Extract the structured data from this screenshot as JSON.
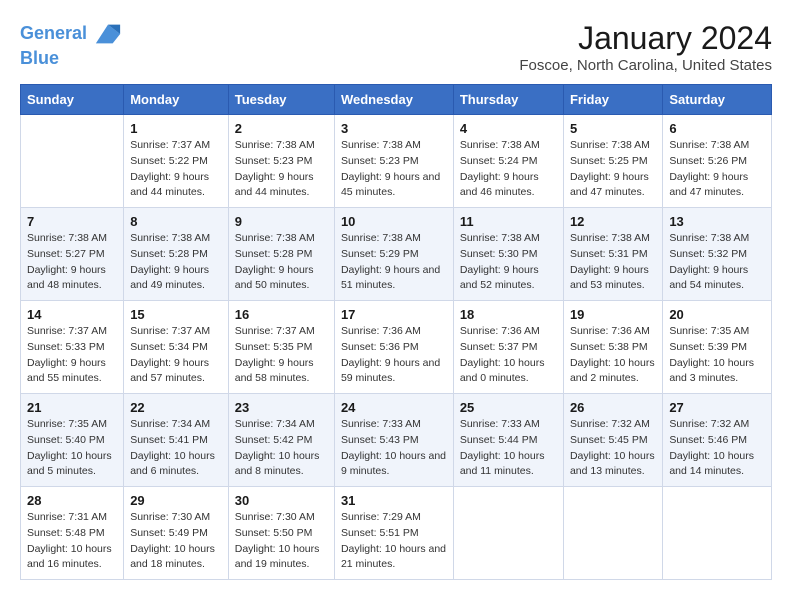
{
  "header": {
    "logo_line1": "General",
    "logo_line2": "Blue",
    "main_title": "January 2024",
    "subtitle": "Foscoe, North Carolina, United States"
  },
  "weekdays": [
    "Sunday",
    "Monday",
    "Tuesday",
    "Wednesday",
    "Thursday",
    "Friday",
    "Saturday"
  ],
  "weeks": [
    [
      null,
      {
        "day": "1",
        "sunrise": "7:37 AM",
        "sunset": "5:22 PM",
        "daylight": "9 hours and 44 minutes."
      },
      {
        "day": "2",
        "sunrise": "7:38 AM",
        "sunset": "5:23 PM",
        "daylight": "9 hours and 44 minutes."
      },
      {
        "day": "3",
        "sunrise": "7:38 AM",
        "sunset": "5:23 PM",
        "daylight": "9 hours and 45 minutes."
      },
      {
        "day": "4",
        "sunrise": "7:38 AM",
        "sunset": "5:24 PM",
        "daylight": "9 hours and 46 minutes."
      },
      {
        "day": "5",
        "sunrise": "7:38 AM",
        "sunset": "5:25 PM",
        "daylight": "9 hours and 47 minutes."
      },
      {
        "day": "6",
        "sunrise": "7:38 AM",
        "sunset": "5:26 PM",
        "daylight": "9 hours and 47 minutes."
      }
    ],
    [
      {
        "day": "7",
        "sunrise": "7:38 AM",
        "sunset": "5:27 PM",
        "daylight": "9 hours and 48 minutes."
      },
      {
        "day": "8",
        "sunrise": "7:38 AM",
        "sunset": "5:28 PM",
        "daylight": "9 hours and 49 minutes."
      },
      {
        "day": "9",
        "sunrise": "7:38 AM",
        "sunset": "5:28 PM",
        "daylight": "9 hours and 50 minutes."
      },
      {
        "day": "10",
        "sunrise": "7:38 AM",
        "sunset": "5:29 PM",
        "daylight": "9 hours and 51 minutes."
      },
      {
        "day": "11",
        "sunrise": "7:38 AM",
        "sunset": "5:30 PM",
        "daylight": "9 hours and 52 minutes."
      },
      {
        "day": "12",
        "sunrise": "7:38 AM",
        "sunset": "5:31 PM",
        "daylight": "9 hours and 53 minutes."
      },
      {
        "day": "13",
        "sunrise": "7:38 AM",
        "sunset": "5:32 PM",
        "daylight": "9 hours and 54 minutes."
      }
    ],
    [
      {
        "day": "14",
        "sunrise": "7:37 AM",
        "sunset": "5:33 PM",
        "daylight": "9 hours and 55 minutes."
      },
      {
        "day": "15",
        "sunrise": "7:37 AM",
        "sunset": "5:34 PM",
        "daylight": "9 hours and 57 minutes."
      },
      {
        "day": "16",
        "sunrise": "7:37 AM",
        "sunset": "5:35 PM",
        "daylight": "9 hours and 58 minutes."
      },
      {
        "day": "17",
        "sunrise": "7:36 AM",
        "sunset": "5:36 PM",
        "daylight": "9 hours and 59 minutes."
      },
      {
        "day": "18",
        "sunrise": "7:36 AM",
        "sunset": "5:37 PM",
        "daylight": "10 hours and 0 minutes."
      },
      {
        "day": "19",
        "sunrise": "7:36 AM",
        "sunset": "5:38 PM",
        "daylight": "10 hours and 2 minutes."
      },
      {
        "day": "20",
        "sunrise": "7:35 AM",
        "sunset": "5:39 PM",
        "daylight": "10 hours and 3 minutes."
      }
    ],
    [
      {
        "day": "21",
        "sunrise": "7:35 AM",
        "sunset": "5:40 PM",
        "daylight": "10 hours and 5 minutes."
      },
      {
        "day": "22",
        "sunrise": "7:34 AM",
        "sunset": "5:41 PM",
        "daylight": "10 hours and 6 minutes."
      },
      {
        "day": "23",
        "sunrise": "7:34 AM",
        "sunset": "5:42 PM",
        "daylight": "10 hours and 8 minutes."
      },
      {
        "day": "24",
        "sunrise": "7:33 AM",
        "sunset": "5:43 PM",
        "daylight": "10 hours and 9 minutes."
      },
      {
        "day": "25",
        "sunrise": "7:33 AM",
        "sunset": "5:44 PM",
        "daylight": "10 hours and 11 minutes."
      },
      {
        "day": "26",
        "sunrise": "7:32 AM",
        "sunset": "5:45 PM",
        "daylight": "10 hours and 13 minutes."
      },
      {
        "day": "27",
        "sunrise": "7:32 AM",
        "sunset": "5:46 PM",
        "daylight": "10 hours and 14 minutes."
      }
    ],
    [
      {
        "day": "28",
        "sunrise": "7:31 AM",
        "sunset": "5:48 PM",
        "daylight": "10 hours and 16 minutes."
      },
      {
        "day": "29",
        "sunrise": "7:30 AM",
        "sunset": "5:49 PM",
        "daylight": "10 hours and 18 minutes."
      },
      {
        "day": "30",
        "sunrise": "7:30 AM",
        "sunset": "5:50 PM",
        "daylight": "10 hours and 19 minutes."
      },
      {
        "day": "31",
        "sunrise": "7:29 AM",
        "sunset": "5:51 PM",
        "daylight": "10 hours and 21 minutes."
      },
      null,
      null,
      null
    ]
  ]
}
